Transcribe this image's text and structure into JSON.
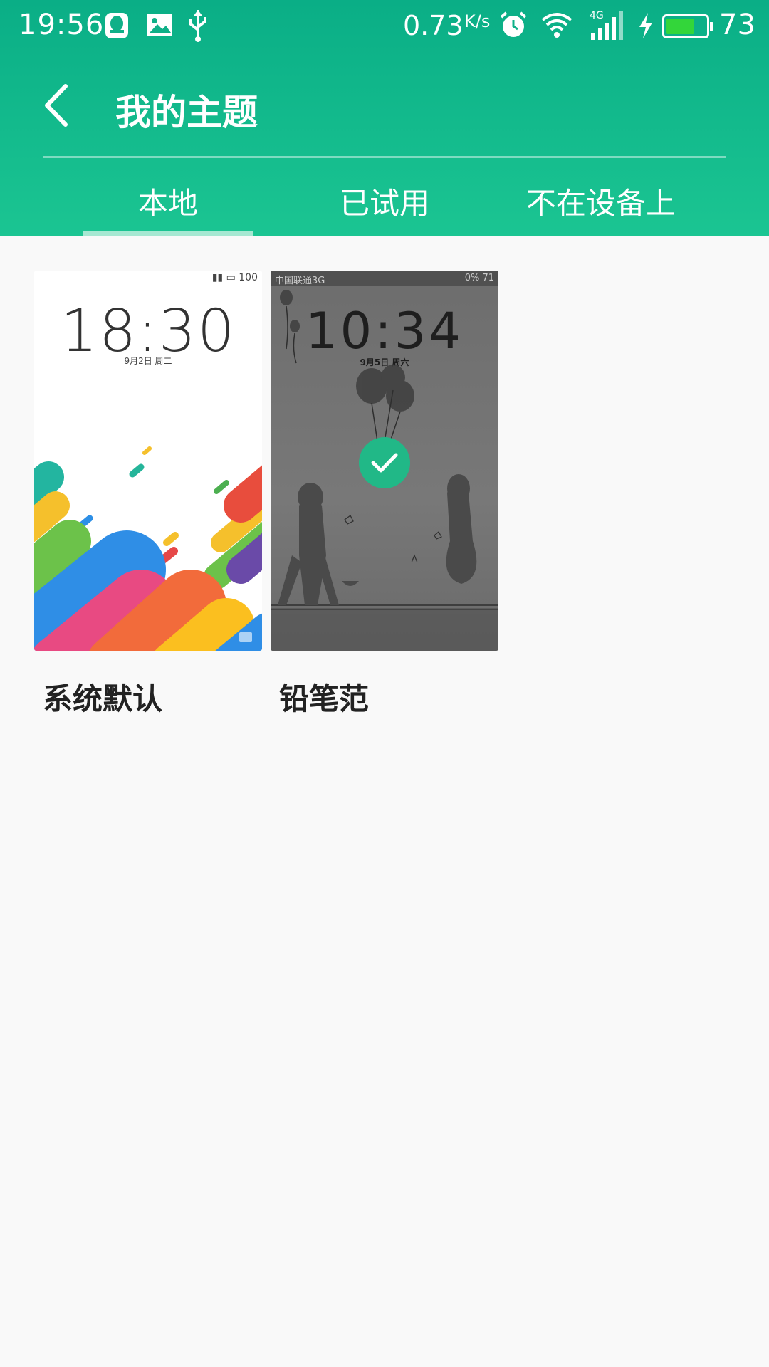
{
  "status_bar": {
    "time": "19:56",
    "net_speed": "0.73",
    "net_unit": "K/s",
    "battery_level": "73",
    "battery_percent": 73,
    "icons": [
      "qq-icon",
      "image-icon",
      "usb-icon",
      "alarm-icon",
      "wifi-icon",
      "signal-4g-icon",
      "charging-icon",
      "battery-icon"
    ]
  },
  "header": {
    "title": "我的主题"
  },
  "tabs": [
    {
      "label": "本地",
      "selected": true
    },
    {
      "label": "已试用",
      "selected": false
    },
    {
      "label": "不在设备上",
      "selected": false
    }
  ],
  "themes": [
    {
      "name": "系统默认",
      "preview": {
        "status": "100",
        "clock": "18:30",
        "date": "9月2日 周二"
      },
      "applied": false
    },
    {
      "name": "铅笔范",
      "preview": {
        "carrier": "中国联通3G",
        "status": "0% 71",
        "clock": "10:34",
        "date": "9月5日 周六"
      },
      "applied": true
    }
  ],
  "colors": {
    "header_top": "#0aae86",
    "header_bottom": "#1bc592",
    "tab_indicator": "#a6e8d2",
    "applied_badge": "#21b887",
    "battery_fill": "#33d63a"
  }
}
